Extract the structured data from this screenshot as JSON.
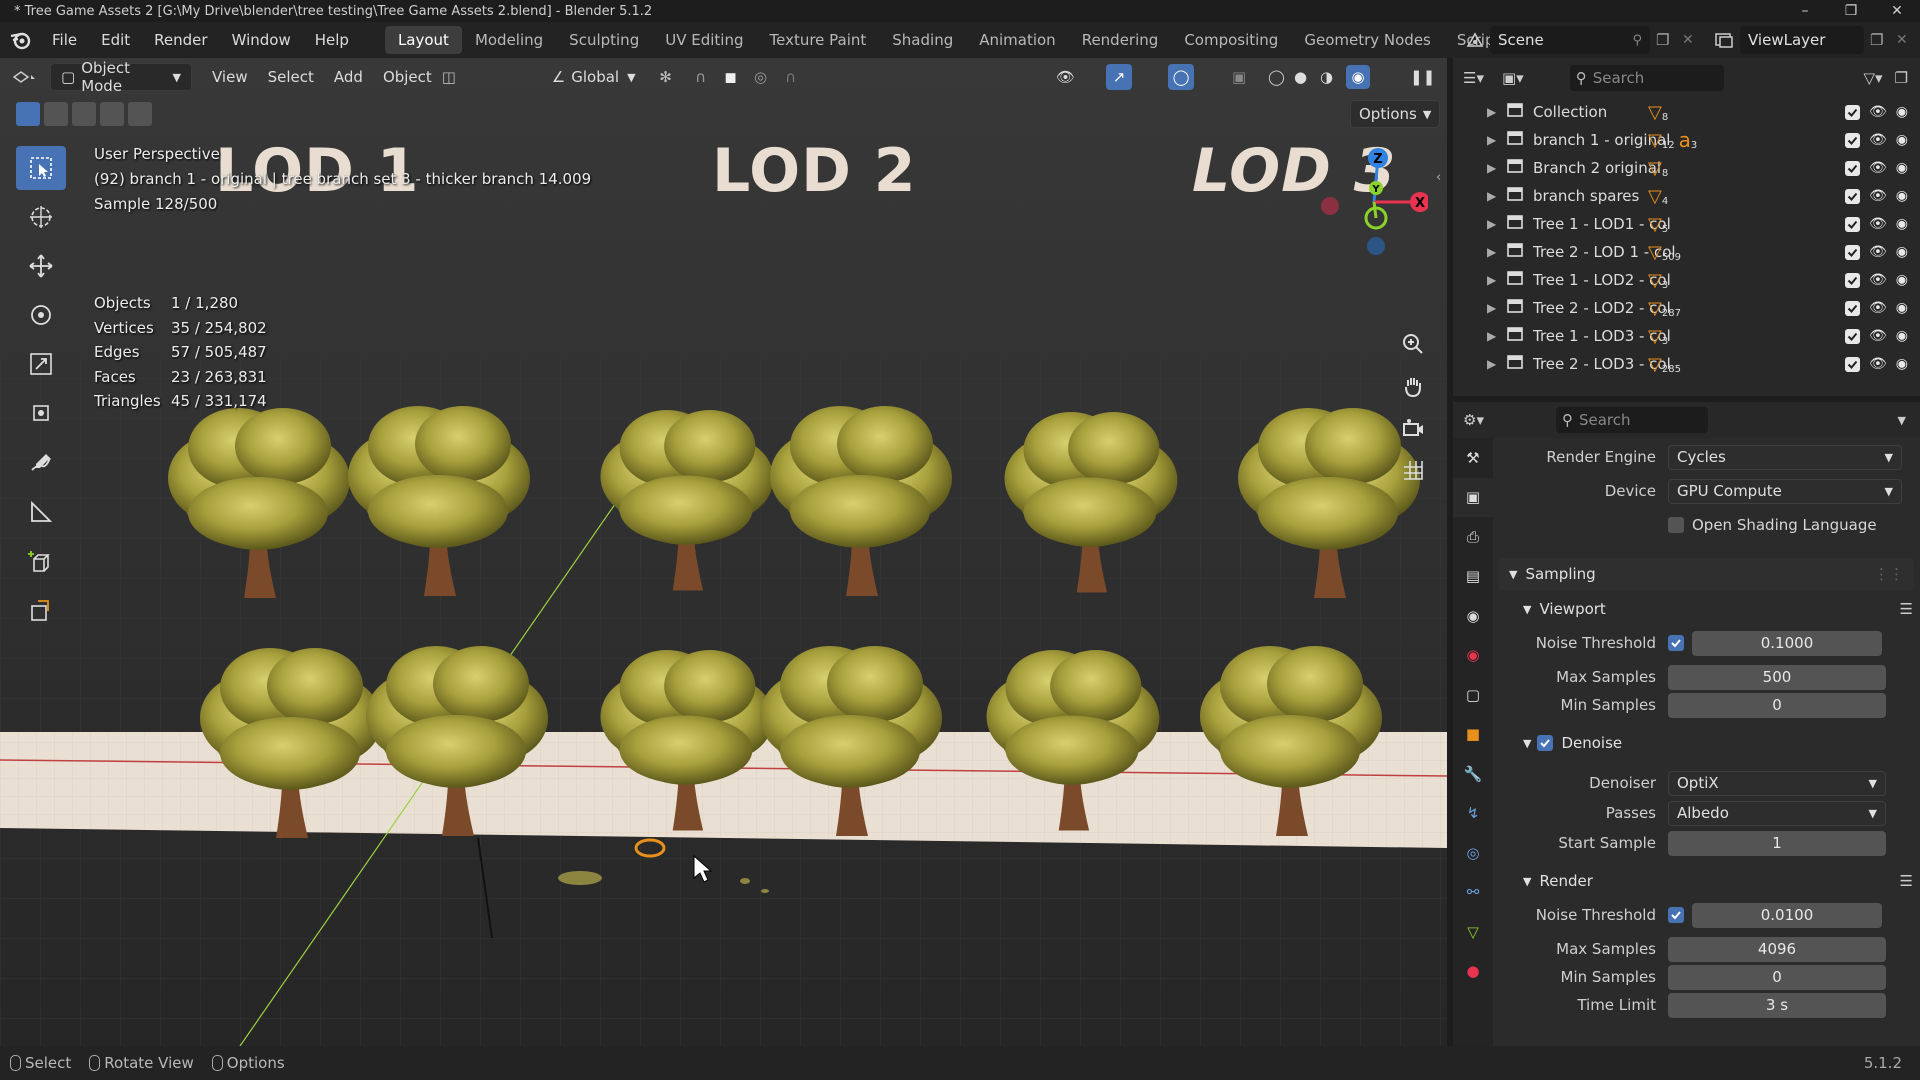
{
  "window": {
    "title": "* Tree Game Assets 2 [G:\\My Drive\\blender\\tree testing\\Tree Game Assets 2.blend] - Blender 5.1.2"
  },
  "menu": [
    "File",
    "Edit",
    "Render",
    "Window",
    "Help"
  ],
  "workspaces": [
    {
      "label": "Layout",
      "active": true
    },
    {
      "label": "Modeling",
      "active": false
    },
    {
      "label": "Sculpting",
      "active": false
    },
    {
      "label": "UV Editing",
      "active": false
    },
    {
      "label": "Texture Paint",
      "active": false
    },
    {
      "label": "Shading",
      "active": false
    },
    {
      "label": "Animation",
      "active": false
    },
    {
      "label": "Rendering",
      "active": false
    },
    {
      "label": "Compositing",
      "active": false
    },
    {
      "label": "Geometry Nodes",
      "active": false
    },
    {
      "label": "Scripting",
      "active": false
    }
  ],
  "scene": {
    "name": "Scene",
    "view_layer": "ViewLayer"
  },
  "viewport": {
    "mode": "Object Mode",
    "menus": [
      "View",
      "Select",
      "Add",
      "Object"
    ],
    "orientation": "Global",
    "options_label": "Options",
    "perspective": "User Perspective",
    "active_object": "(92) branch 1 - original | tree branch set 3 - thicker branch 14.009",
    "sample": "Sample 128/500",
    "stats": [
      {
        "k": "Objects",
        "v": "1 / 1,280"
      },
      {
        "k": "Vertices",
        "v": "35 / 254,802"
      },
      {
        "k": "Edges",
        "v": "57 / 505,487"
      },
      {
        "k": "Faces",
        "v": "23 / 263,831"
      },
      {
        "k": "Triangles",
        "v": "45 / 331,174"
      }
    ],
    "lod_labels": [
      "LOD 1",
      "LOD 2",
      "LOD 3"
    ],
    "gizmo_axes": {
      "x": "X",
      "y": "Y",
      "z": "Z"
    }
  },
  "outliner": {
    "search_placeholder": "Search",
    "rows": [
      {
        "name": "Collection",
        "count": "8"
      },
      {
        "name": "branch 1 - original",
        "count": "12",
        "count2": "3"
      },
      {
        "name": "Branch 2 original",
        "count": "8"
      },
      {
        "name": "branch spares",
        "count": "4"
      },
      {
        "name": "Tree 1 - LOD1 - col",
        "count": "5"
      },
      {
        "name": "Tree 2 - LOD 1 - col",
        "count": "509"
      },
      {
        "name": "Tree 1 - LOD2 - col",
        "count": "3"
      },
      {
        "name": "Tree 2 - LOD2 - col",
        "count": "287"
      },
      {
        "name": "Tree 1 - LOD3 - col",
        "count": "3"
      },
      {
        "name": "Tree 2 - LOD3 - col",
        "count": "285"
      }
    ]
  },
  "properties": {
    "search_placeholder": "Search",
    "render_engine_label": "Render Engine",
    "render_engine": "Cycles",
    "device_label": "Device",
    "device": "GPU Compute",
    "osl_label": "Open Shading Language",
    "sampling_label": "Sampling",
    "viewport_label": "Viewport",
    "vp_noise_threshold_label": "Noise Threshold",
    "vp_noise_threshold": "0.1000",
    "vp_max_samples_label": "Max Samples",
    "vp_max_samples": "500",
    "vp_min_samples_label": "Min Samples",
    "vp_min_samples": "0",
    "denoise_label": "Denoise",
    "denoiser_label": "Denoiser",
    "denoiser": "OptiX",
    "passes_label": "Passes",
    "passes": "Albedo",
    "start_sample_label": "Start Sample",
    "start_sample": "1",
    "render_label": "Render",
    "r_noise_threshold_label": "Noise Threshold",
    "r_noise_threshold": "0.0100",
    "r_max_samples_label": "Max Samples",
    "r_max_samples": "4096",
    "r_min_samples_label": "Min Samples",
    "r_min_samples": "0",
    "time_limit_label": "Time Limit",
    "time_limit": "3 s"
  },
  "statusbar": {
    "select": "Select",
    "rotate": "Rotate View",
    "options": "Options",
    "version": "5.1.2"
  },
  "colors": {
    "accent": "#4772b3",
    "axis_x": "#e8344e",
    "axis_y": "#8bd22b",
    "axis_z": "#2f83e3",
    "foliage": "#a8a03c",
    "trunk": "#7a4a2a"
  }
}
